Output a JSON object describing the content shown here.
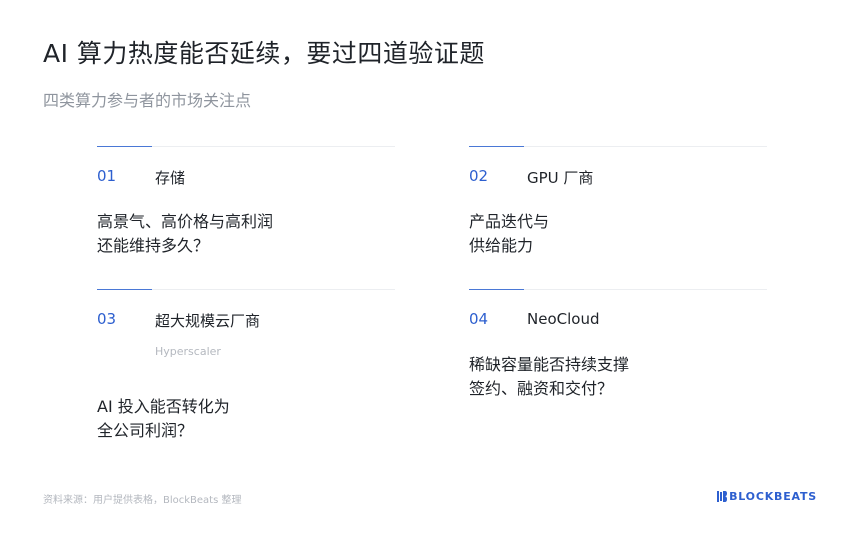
{
  "header": {
    "title": "AI 算力热度能否延续，要过四道验证题",
    "subtitle": "四类算力参与者的市场关注点"
  },
  "cards": [
    {
      "num": "01",
      "name": "存储",
      "sub": "",
      "q1": "高景气、高价格与高利润",
      "q2": "还能维持多久？"
    },
    {
      "num": "02",
      "name": "GPU 厂商",
      "sub": "",
      "q1": "产品迭代与",
      "q2": "供给能力"
    },
    {
      "num": "03",
      "name": "超大规模云厂商",
      "sub": "Hyperscaler",
      "q1": "AI 投入能否转化为",
      "q2": "全公司利润？"
    },
    {
      "num": "04",
      "name": "NeoCloud",
      "sub": "",
      "q1": "稀缺容量能否持续支撑",
      "q2": "签约、融资和交付？"
    }
  ],
  "footer": {
    "source": "资料来源：用户提供表格，BlockBeats 整理",
    "logo_text": "BLOCKBEATS"
  },
  "colors": {
    "accent": "#2d5fcf",
    "text": "#1f2329",
    "muted": "#8f959e",
    "rule": "#eceef1"
  }
}
